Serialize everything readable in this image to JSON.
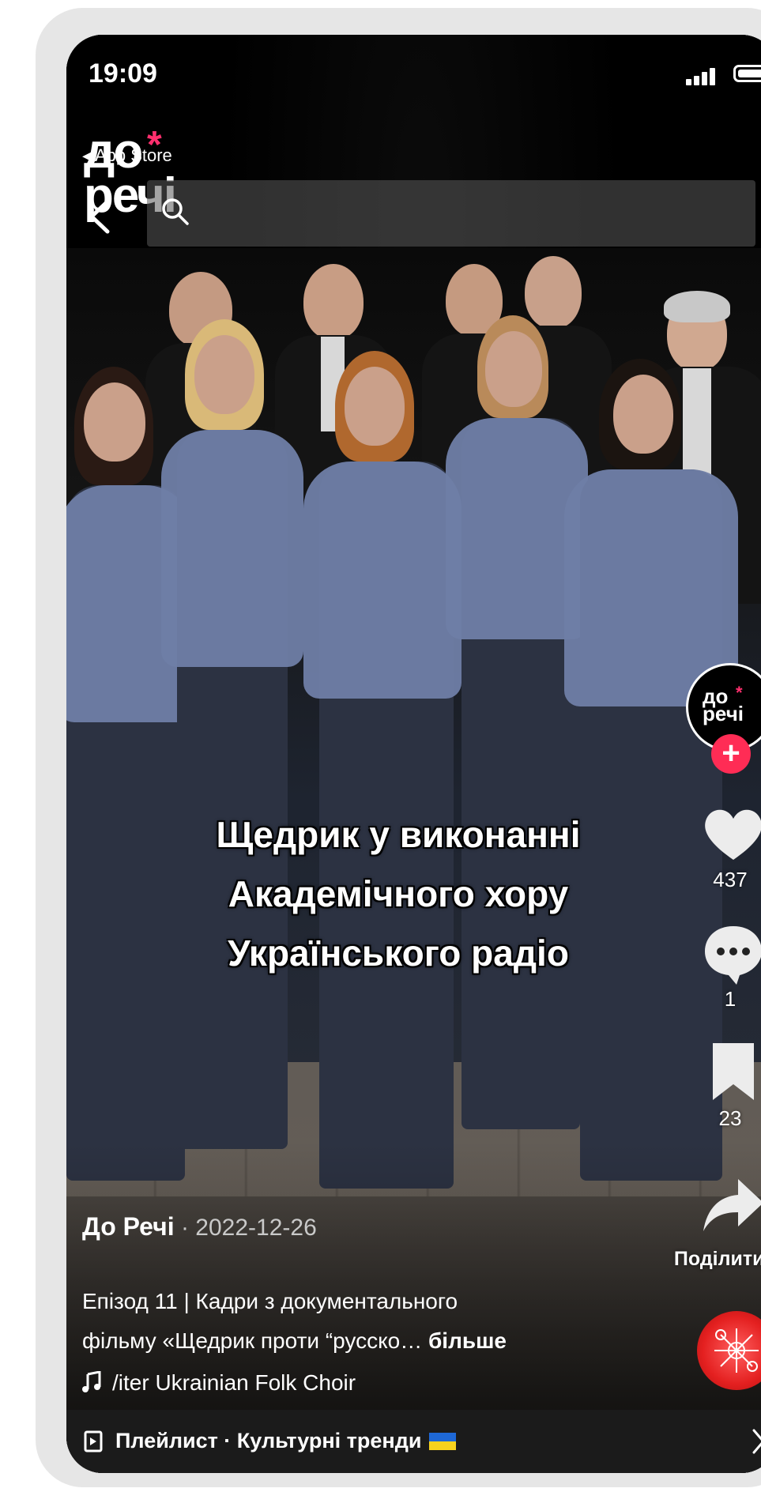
{
  "status_bar": {
    "time": "19:09"
  },
  "top_bar": {
    "back_app": "App Store",
    "logo_text_line1": "до",
    "logo_text_line2": "речі",
    "logo_star": "*"
  },
  "video": {
    "subtitle_lines": [
      "Щедрик у виконанні",
      "Академічного хору",
      "Українського радіо"
    ]
  },
  "actions": {
    "avatar_text_line1": "до",
    "avatar_text_line2": "речі",
    "follow_label": "+",
    "likes": "437",
    "comments": "1",
    "saves": "23",
    "share_label": "Поділитися"
  },
  "caption": {
    "author": "До Речі",
    "date": " · 2022-12-26",
    "line1": "Епізод 11 | Кадри з документального",
    "line2_prefix": "фільму «Щедрик проти “русско…",
    "more": " більше",
    "music": "/iter Ukrainian Folk Choir"
  },
  "playlist": {
    "text": "Плейлист · Культурні тренди"
  },
  "colors": {
    "accent_pink": "#ff2c55",
    "logo_pink": "#ff2f6e",
    "flag_blue": "#1e68d6",
    "flag_yellow": "#f7d21e"
  }
}
